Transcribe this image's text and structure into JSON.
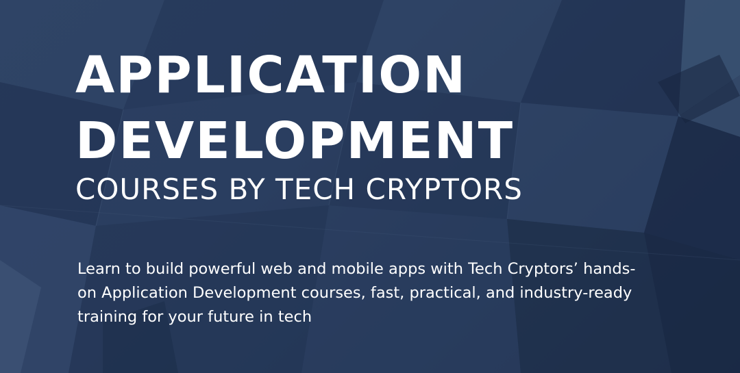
{
  "hero": {
    "title_line1": "APPLICATION",
    "title_line2": "DEVELOPMENT",
    "subtitle": "COURSES BY TECH CRYPTORS",
    "description": "Learn to build powerful web and mobile apps with Tech Cryptors’ hands-on Application Development courses, fast, practical, and industry-ready training for your future in tech"
  },
  "colors": {
    "background": "#2c4163",
    "text": "#ffffff"
  }
}
